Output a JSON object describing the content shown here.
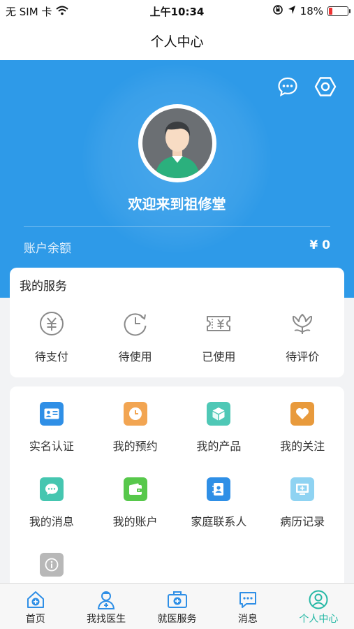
{
  "status_bar": {
    "carrier": "无 SIM 卡",
    "time": "上午10:34",
    "battery": "18%",
    "battery_level": 0.18
  },
  "nav": {
    "title": "个人中心"
  },
  "header": {
    "welcome": "欢迎来到祖修堂",
    "balance_label": "账户余额",
    "balance_value": "¥ 0",
    "message_icon": "chat-bubble-icon",
    "settings_icon": "hexagon-settings-icon",
    "bg_color": "#2e9ae8"
  },
  "services": {
    "title": "我的服务",
    "items": [
      {
        "label": "待支付",
        "icon": "yuan-circle-icon"
      },
      {
        "label": "待使用",
        "icon": "clock-refresh-icon"
      },
      {
        "label": "已使用",
        "icon": "ticket-yuan-icon"
      },
      {
        "label": "待评价",
        "icon": "flower-icon"
      }
    ]
  },
  "grid": {
    "items": [
      {
        "label": "实名认证",
        "icon": "id-card-icon",
        "color": "#2f8fe6"
      },
      {
        "label": "我的预约",
        "icon": "clock-icon",
        "color": "#f2a552"
      },
      {
        "label": "我的产品",
        "icon": "cube-icon",
        "color": "#4fc8b6"
      },
      {
        "label": "我的关注",
        "icon": "heart-icon",
        "color": "#e89a3c"
      },
      {
        "label": "我的消息",
        "icon": "message-dots-icon",
        "color": "#45c6b0"
      },
      {
        "label": "我的账户",
        "icon": "wallet-icon",
        "color": "#57c84b"
      },
      {
        "label": "家庭联系人",
        "icon": "contact-book-icon",
        "color": "#2f8fe6"
      },
      {
        "label": "病历记录",
        "icon": "medical-record-icon",
        "color": "#8fd3f2"
      },
      {
        "label": "",
        "icon": "info-icon",
        "color": "#b8b8b8"
      }
    ]
  },
  "tabbar": {
    "items": [
      {
        "label": "首页",
        "icon": "home-plus-icon",
        "active": false
      },
      {
        "label": "我找医生",
        "icon": "doctor-icon",
        "active": false
      },
      {
        "label": "就医服务",
        "icon": "medical-kit-icon",
        "active": false
      },
      {
        "label": "消息",
        "icon": "message-icon",
        "active": false
      },
      {
        "label": "个人中心",
        "icon": "user-circle-icon",
        "active": true
      }
    ],
    "active_color": "#25b8a5"
  }
}
